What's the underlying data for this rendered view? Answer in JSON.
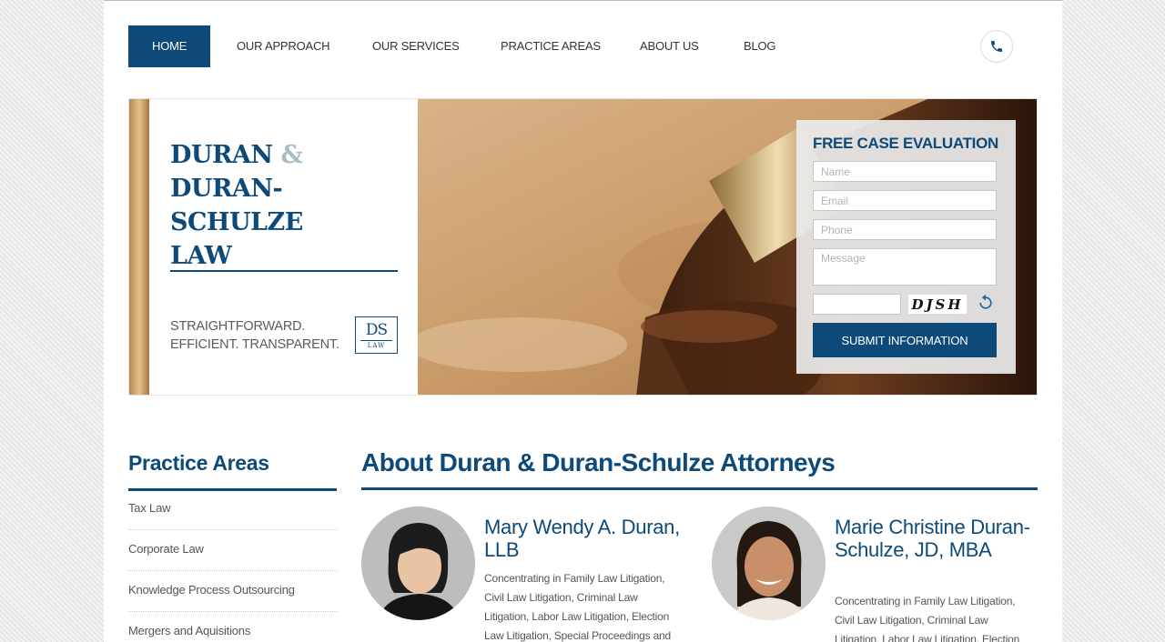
{
  "nav": {
    "items": [
      {
        "label": "HOME",
        "active": true
      },
      {
        "label": "OUR APPROACH"
      },
      {
        "label": "OUR SERVICES"
      },
      {
        "label": "PRACTICE AREAS"
      },
      {
        "label": "ABOUT US"
      },
      {
        "label": "BLOG"
      }
    ],
    "phone_icon": "phone-icon"
  },
  "hero": {
    "brand_line1": "DURAN",
    "brand_amp": "&",
    "brand_line2": "DURAN-SCHULZE",
    "brand_line3": "LAW",
    "tagline_line1": "STRAIGHTFORWARD.",
    "tagline_line2": "EFFICIENT. TRANSPARENT.",
    "logo_text": "DS",
    "logo_sub": "LAW"
  },
  "form": {
    "title": "FREE CASE EVALUATION",
    "name_placeholder": "Name",
    "email_placeholder": "Email",
    "phone_placeholder": "Phone",
    "message_placeholder": "Message",
    "captcha_text": "DJSH",
    "refresh_icon": "refresh-icon",
    "submit_label": "SUBMIT INFORMATION"
  },
  "sidebar": {
    "title": "Practice Areas",
    "items": [
      "Tax Law",
      "Corporate Law",
      "Knowledge Process Outsourcing",
      "Mergers and Aquisitions"
    ]
  },
  "main": {
    "title": "About Duran & Duran-Schulze Attorneys",
    "attorneys": [
      {
        "name": "Mary Wendy A. Duran, LLB",
        "description": "Concentrating in Family Law Litigation, Civil Law Litigation, Criminal Law Litigation, Labor Law Litigation, Election Law Litigation, Special Proceedings and"
      },
      {
        "name": "Marie Christine Duran-Schulze, JD, MBA",
        "description": "Concentrating in Family Law Litigation, Civil Law Litigation, Criminal Law Litigation, Labor Law Litigation, Election"
      }
    ]
  },
  "colors": {
    "brand_blue": "#0d4a79",
    "page_bg": "#ffffff"
  }
}
